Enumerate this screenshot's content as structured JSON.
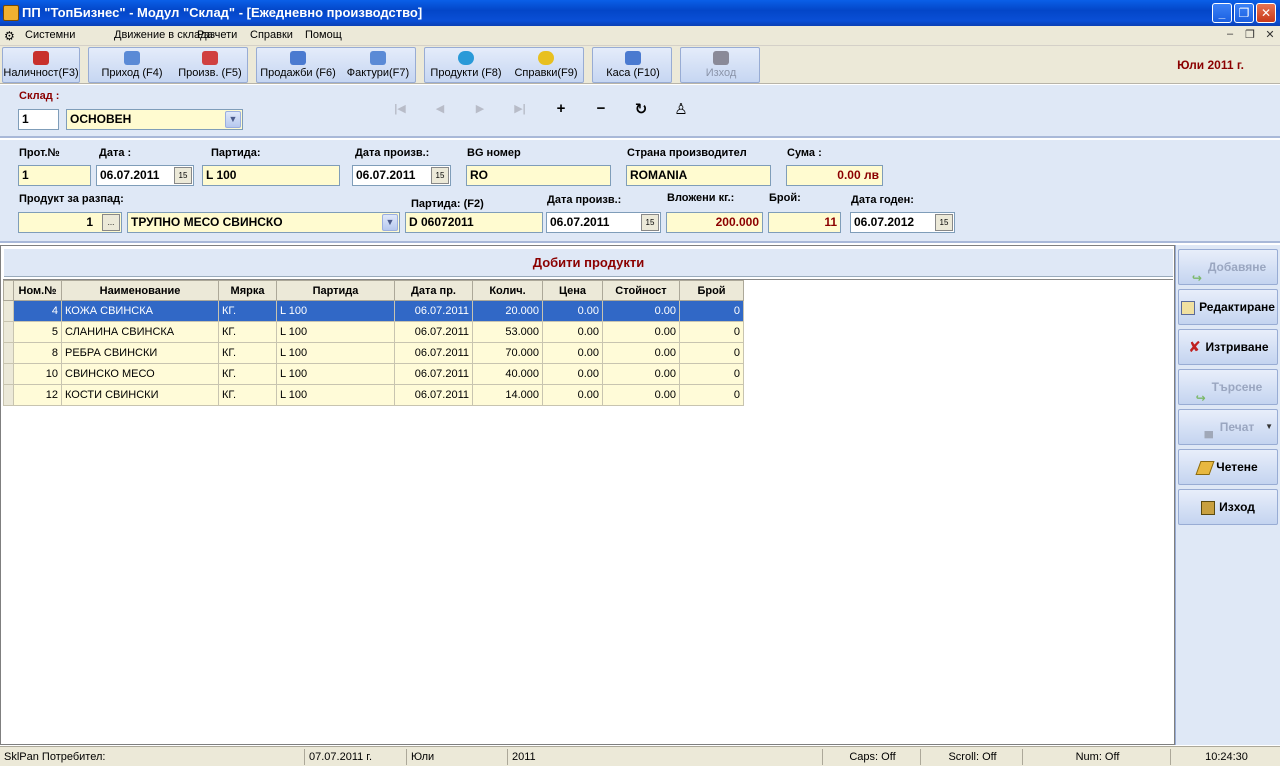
{
  "window": {
    "title": "ПП \"ТопБизнес\" - Модул \"Склад\" - [Ежедневно производство]"
  },
  "menu": [
    "Системни",
    "Движение в склада",
    "Разчети",
    "Справки",
    "Помощ"
  ],
  "toolbar": {
    "buttons": [
      {
        "label": "Наличност(F3)"
      },
      {
        "label": "Приход (F4)"
      },
      {
        "label": "Произв. (F5)"
      },
      {
        "label": "Продажби (F6)"
      },
      {
        "label": "Фактури(F7)"
      },
      {
        "label": "Продукти (F8)"
      },
      {
        "label": "Справки(F9)"
      },
      {
        "label": "Каса (F10)"
      },
      {
        "label": "Изход"
      }
    ],
    "period": "Юли  2011 г."
  },
  "warehouse": {
    "label": "Склад :",
    "code": "1",
    "name": "ОСНОВЕН"
  },
  "nav": {
    "first": "|◀",
    "prev": "◀",
    "next": "▶",
    "last": "▶|",
    "add": "+",
    "remove": "−",
    "refresh": "↻",
    "post": "♙"
  },
  "form": {
    "prot_label": "Прот.№",
    "prot": "1",
    "date_label": "Дата :",
    "date": "06.07.2011",
    "batch_label": "Партида:",
    "batch": "L 100",
    "prod_date_label": "Дата произв.:",
    "prod_date": "06.07.2011",
    "bg_label": "BG номер",
    "bg": "RO",
    "country_label": "Страна производител",
    "country": "ROMANIA",
    "sum_label": "Сума :",
    "sum": "0.00 лв",
    "product_label": "Продукт за разпад:",
    "product_code": "1",
    "product_name": "ТРУПНО МЕСО СВИНСКО",
    "batch2_label": "Партида:  (F2)",
    "batch2": "D 06072011",
    "prod_date2_label": "Дата произв.:",
    "prod_date2": "06.07.2011",
    "kg_label": "Вложени кг.:",
    "kg": "200.000",
    "count_label": "Брой:",
    "count": "11",
    "expiry_label": "Дата годен:",
    "expiry": "06.07.2012",
    "date_btn": "15",
    "browse_btn": "...",
    "drop_btn": "▼"
  },
  "grid": {
    "title": "Добити продукти",
    "columns": [
      "Ном.№",
      "Наименование",
      "Мярка",
      "Партида",
      "Дата пр.",
      "Колич.",
      "Цена",
      "Стойност",
      "Брой"
    ],
    "rows": [
      [
        "4",
        "КОЖА СВИНСКА",
        "КГ.",
        "L 100",
        "06.07.2011",
        "20.000",
        "0.00",
        "0.00",
        "0"
      ],
      [
        "5",
        "СЛАНИНА  СВИНСКА",
        "КГ.",
        "L 100",
        "06.07.2011",
        "53.000",
        "0.00",
        "0.00",
        "0"
      ],
      [
        "8",
        "РЕБРА СВИНСКИ",
        "КГ.",
        "L 100",
        "06.07.2011",
        "70.000",
        "0.00",
        "0.00",
        "0"
      ],
      [
        "10",
        "СВИНСКО МЕСО",
        "КГ.",
        "L 100",
        "06.07.2011",
        "40.000",
        "0.00",
        "0.00",
        "0"
      ],
      [
        "12",
        "КОСТИ СВИНСКИ",
        "КГ.",
        "L 100",
        "06.07.2011",
        "14.000",
        "0.00",
        "0.00",
        "0"
      ]
    ]
  },
  "side": {
    "add": "Добавяне",
    "edit": "Редактиране",
    "delete": "Изтриване",
    "search": "Търсене",
    "print": "Печат",
    "read": "Четене",
    "exit": "Изход"
  },
  "status": {
    "user": "SklPan Потребител:",
    "date": "07.07.2011 г.",
    "month": "Юли",
    "year": "2011",
    "caps": "Caps: Off",
    "scroll": "Scroll: Off",
    "num": "Num: Off",
    "time": "10:24:30"
  },
  "colors": {
    "accent": "#8b0000",
    "selection": "#3168c6",
    "panel": "#dfe8f6",
    "titlebar": "#0a4fd6"
  }
}
